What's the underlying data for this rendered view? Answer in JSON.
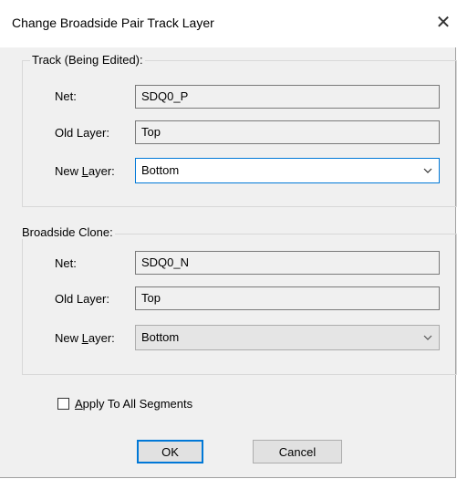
{
  "window": {
    "title": "Change Broadside Pair Track Layer",
    "close_glyph": "✕"
  },
  "track_group": {
    "legend": "Track (Being Edited):",
    "net_label": "Net:",
    "net_value": "SDQ0_P",
    "old_layer_label": "Old Layer:",
    "old_layer_value": "Top",
    "new_layer_label_pre": "New ",
    "new_layer_label_underlined": "L",
    "new_layer_label_post": "ayer:",
    "new_layer_value": "Bottom"
  },
  "clone_group": {
    "legend": "Broadside Clone:",
    "net_label": "Net:",
    "net_value": "SDQ0_N",
    "old_layer_label": "Old Layer:",
    "old_layer_value": "Top",
    "new_layer_label_pre": "New ",
    "new_layer_label_underlined": "L",
    "new_layer_label_post": "ayer:",
    "new_layer_value": "Bottom"
  },
  "apply_all": {
    "label_underlined": "A",
    "label_rest": "pply To All Segments",
    "checked": false
  },
  "buttons": {
    "ok": "OK",
    "cancel": "Cancel"
  },
  "colors": {
    "accent": "#0078d7",
    "dialog_bg": "#f0f0f0"
  }
}
